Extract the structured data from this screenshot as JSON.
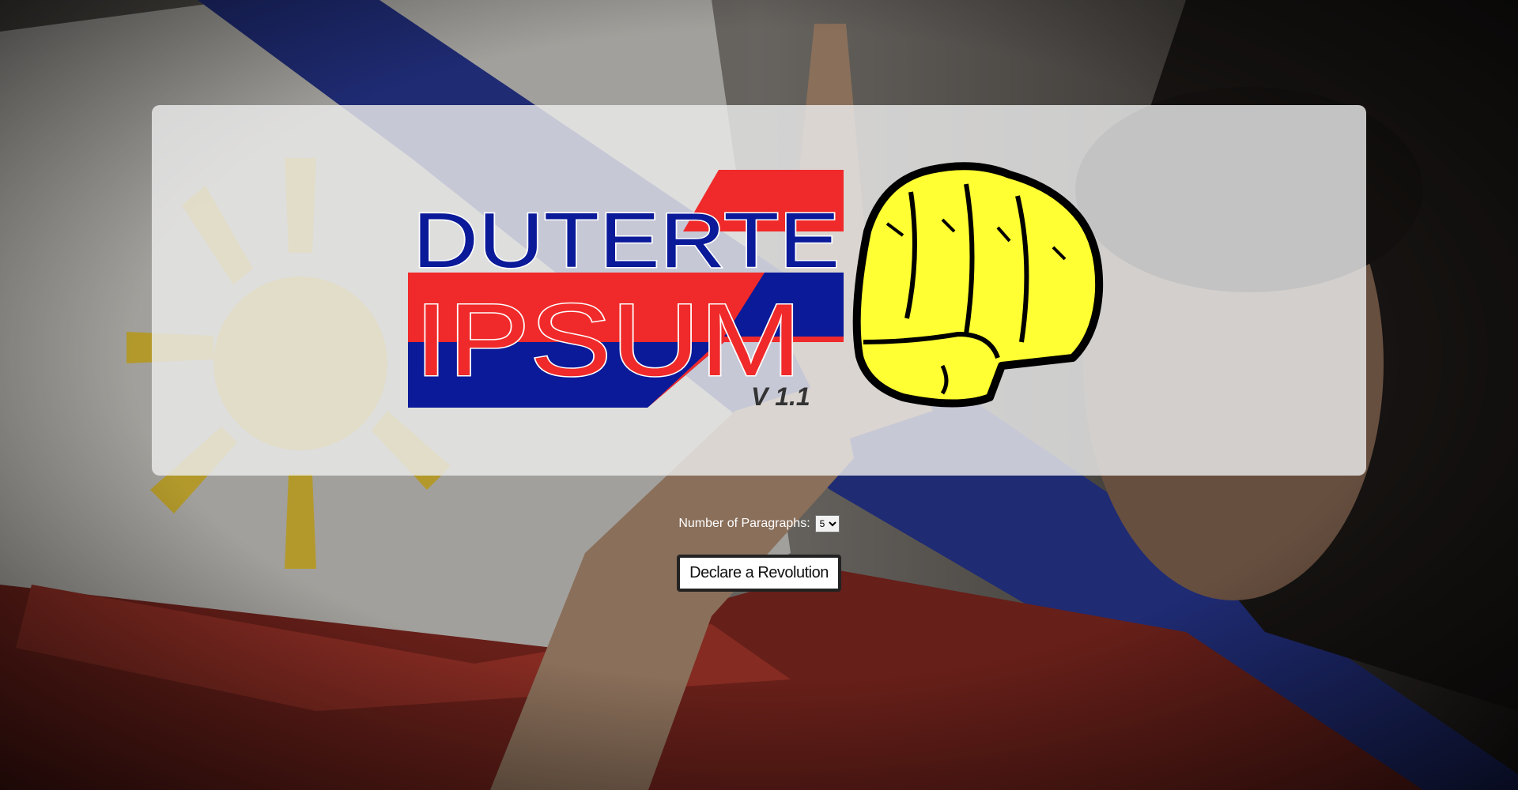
{
  "logo": {
    "line1": "DUTERTE",
    "line2": "IPSUM",
    "version": "V 1.1"
  },
  "form": {
    "paragraphs_label": "Number of Paragraphs:",
    "paragraphs_value": "5",
    "submit_label": "Declare a Revolution"
  },
  "colors": {
    "flag_blue": "#0a1a99",
    "flag_red": "#f02a2a",
    "fist_yellow": "#ffff33",
    "sun_yellow": "#f2cc2a"
  }
}
